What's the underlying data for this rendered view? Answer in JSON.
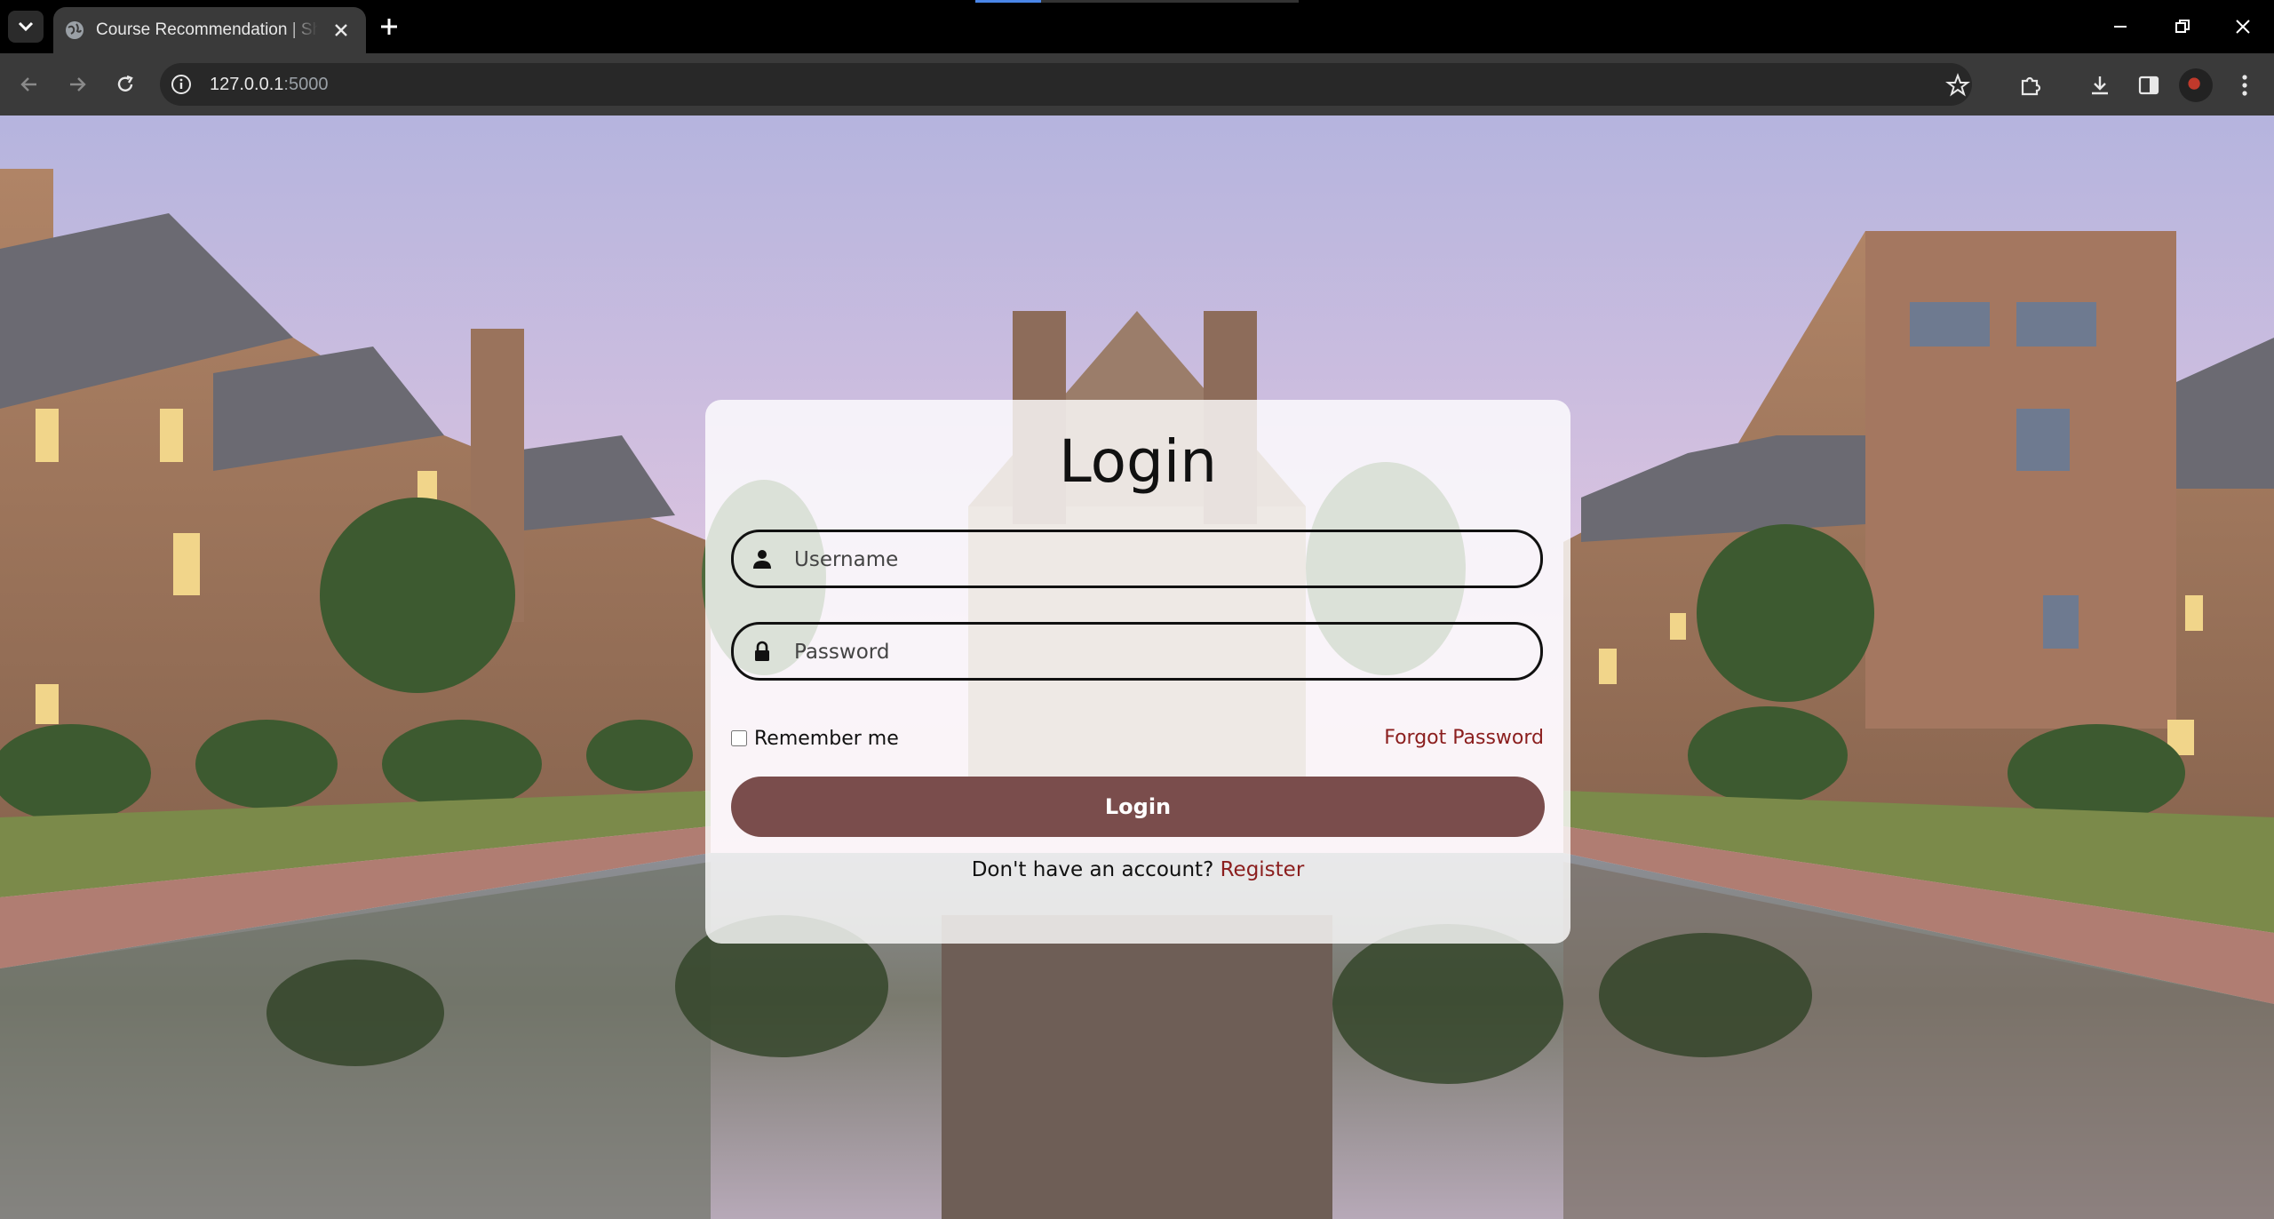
{
  "browser": {
    "tab_title": "Course Recommendation | Shreya",
    "url_host": "127.0.0.1",
    "url_port": ":5000",
    "accent": "#4a86e8"
  },
  "login": {
    "title": "Login",
    "username_placeholder": "Username",
    "password_placeholder": "Password",
    "remember_label": "Remember me",
    "forgot_label": "Forgot Password",
    "button_label": "Login",
    "no_account_text": "Don't have an account?",
    "register_label": "Register",
    "button_color": "#7a4d4c",
    "link_color": "#8b1e1e"
  },
  "icons": {
    "username": "user-icon",
    "password": "lock-icon"
  }
}
